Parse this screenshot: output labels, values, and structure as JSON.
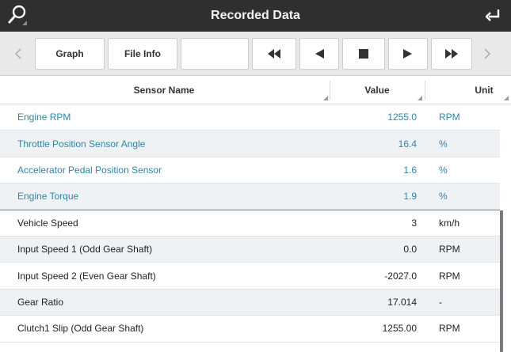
{
  "header": {
    "title": "Recorded Data"
  },
  "toolbar": {
    "graph_label": "Graph",
    "file_info_label": "File Info",
    "blank_label": ""
  },
  "columns": {
    "sensor_name": "Sensor Name",
    "value": "Value",
    "unit": "Unit"
  },
  "rows": [
    {
      "name": "Engine RPM",
      "value": "1255.0",
      "unit": "RPM"
    },
    {
      "name": "Throttle Position Sensor Angle",
      "value": "16.4",
      "unit": "%"
    },
    {
      "name": "Accelerator Pedal Position Sensor",
      "value": "1.6",
      "unit": "%"
    },
    {
      "name": "Engine Torque",
      "value": "1.9",
      "unit": "%"
    },
    {
      "name": "Vehicle Speed",
      "value": "3",
      "unit": "km/h"
    },
    {
      "name": "Input Speed 1 (Odd Gear Shaft)",
      "value": "0.0",
      "unit": "RPM"
    },
    {
      "name": "Input Speed 2 (Even Gear Shaft)",
      "value": "-2027.0",
      "unit": "RPM"
    },
    {
      "name": "Gear Ratio",
      "value": "17.014",
      "unit": "-"
    },
    {
      "name": "Clutch1 Slip (Odd Gear Shaft)",
      "value": "1255.00",
      "unit": "RPM"
    }
  ],
  "colors": {
    "titlebar": "#2f2f2f",
    "toolbar": "#e9e9e9",
    "selected_text": "#2f86a8",
    "alt_row": "#eef2f4",
    "separator": "#3c8dbc"
  },
  "icons": {
    "search": "search-icon",
    "back": "return-arrow-icon",
    "prev": "chevron-left-icon",
    "next": "chevron-right-icon",
    "rewind": "rewind-icon",
    "step_back": "step-back-icon",
    "stop": "stop-icon",
    "play": "play-icon",
    "fast_forward": "fast-forward-icon"
  }
}
